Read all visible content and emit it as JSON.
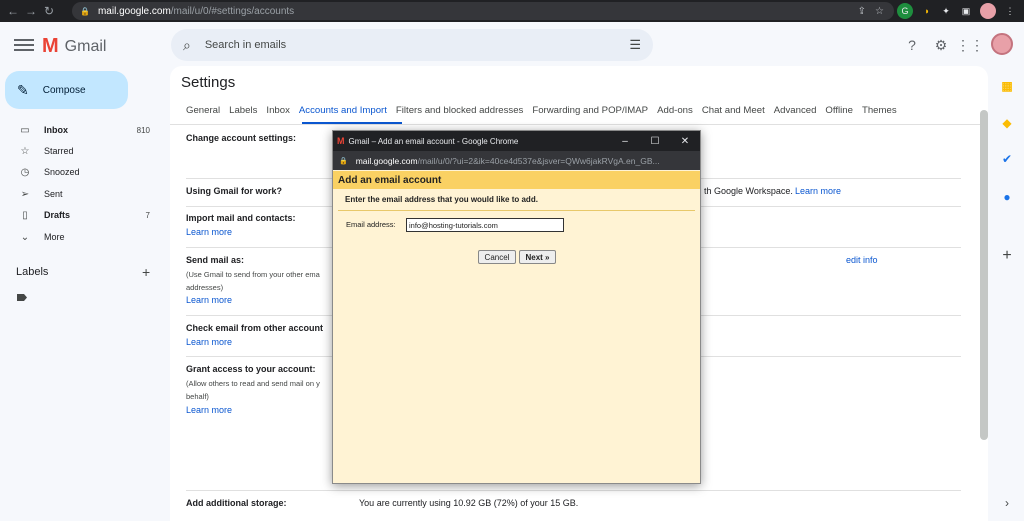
{
  "browser": {
    "url_host": "mail.google.com",
    "url_path": "/mail/u/0/#settings/accounts"
  },
  "header": {
    "app_name": "Gmail",
    "search_placeholder": "Search in emails"
  },
  "nav": {
    "compose": "Compose",
    "items": [
      {
        "label": "Inbox",
        "count": "810",
        "icon": "inbox-icon"
      },
      {
        "label": "Starred",
        "count": "",
        "icon": "star-icon"
      },
      {
        "label": "Snoozed",
        "count": "",
        "icon": "clock-icon"
      },
      {
        "label": "Sent",
        "count": "",
        "icon": "send-icon"
      },
      {
        "label": "Drafts",
        "count": "7",
        "icon": "draft-icon"
      },
      {
        "label": "More",
        "count": "",
        "icon": "chevron-down-icon"
      }
    ],
    "labels_title": "Labels"
  },
  "settings": {
    "title": "Settings",
    "tabs": [
      "General",
      "Labels",
      "Inbox",
      "Accounts and Import",
      "Filters and blocked addresses",
      "Forwarding and POP/IMAP",
      "Add-ons",
      "Chat and Meet",
      "Advanced",
      "Offline",
      "Themes"
    ],
    "active_tab": "Accounts and Import",
    "rows": {
      "change_account": "Change account settings:",
      "work": "Using Gmail for work?",
      "work_right": "th Google Workspace.",
      "learn_more": "Learn more",
      "import": "Import mail and contacts:",
      "send_as": "Send mail as:",
      "send_as_sub1": "(Use Gmail to send from your other ema",
      "send_as_sub2": "addresses)",
      "edit_info": "edit info",
      "check_email": "Check email from other account",
      "grant": "Grant access to your account:",
      "grant_sub1": "(Allow others to read and send mail on y",
      "grant_sub2": "behalf)",
      "storage": "Add additional storage:",
      "storage_text": "You are currently using 10.92 GB (72%) of your 15 GB."
    }
  },
  "popup": {
    "window_title": "Gmail – Add an email account - Google Chrome",
    "url_host": "mail.google.com",
    "url_path": "/mail/u/0/?ui=2&ik=40ce4d537e&jsver=QWw6jakRVgA.en_GB...",
    "heading": "Add an email account",
    "instruction": "Enter the email address that you would like to add.",
    "email_label": "Email address:",
    "email_value": "info@hosting-tutorials.com",
    "cancel": "Cancel",
    "next": "Next »"
  }
}
